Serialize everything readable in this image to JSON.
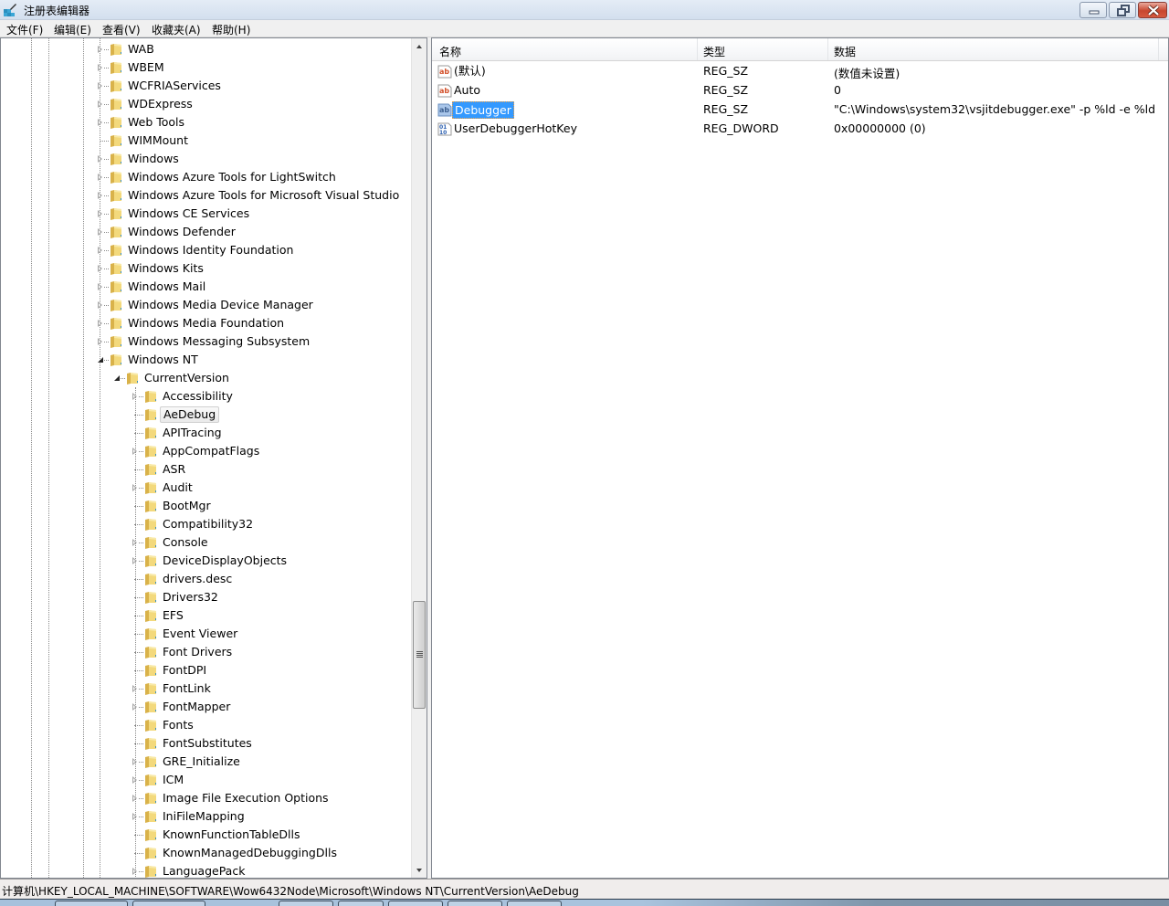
{
  "window": {
    "title": "注册表编辑器",
    "controls": {
      "minimize": "minimize",
      "maximize": "restore",
      "close": "close"
    }
  },
  "menu": [
    {
      "label": "文件(F)"
    },
    {
      "label": "编辑(E)"
    },
    {
      "label": "查看(V)"
    },
    {
      "label": "收藏夹(A)"
    },
    {
      "label": "帮助(H)"
    }
  ],
  "tree": {
    "items": [
      {
        "label": "WAB",
        "level": 0,
        "expander": "closed"
      },
      {
        "label": "WBEM",
        "level": 0,
        "expander": "closed"
      },
      {
        "label": "WCFRIAServices",
        "level": 0,
        "expander": "closed"
      },
      {
        "label": "WDExpress",
        "level": 0,
        "expander": "closed"
      },
      {
        "label": "Web Tools",
        "level": 0,
        "expander": "closed"
      },
      {
        "label": "WIMMount",
        "level": 0,
        "expander": "none"
      },
      {
        "label": "Windows",
        "level": 0,
        "expander": "closed"
      },
      {
        "label": "Windows Azure Tools for LightSwitch",
        "level": 0,
        "expander": "closed"
      },
      {
        "label": "Windows Azure Tools for Microsoft Visual Studio",
        "level": 0,
        "expander": "closed"
      },
      {
        "label": "Windows CE Services",
        "level": 0,
        "expander": "closed"
      },
      {
        "label": "Windows Defender",
        "level": 0,
        "expander": "closed"
      },
      {
        "label": "Windows Identity Foundation",
        "level": 0,
        "expander": "closed"
      },
      {
        "label": "Windows Kits",
        "level": 0,
        "expander": "closed"
      },
      {
        "label": "Windows Mail",
        "level": 0,
        "expander": "closed"
      },
      {
        "label": "Windows Media Device Manager",
        "level": 0,
        "expander": "closed"
      },
      {
        "label": "Windows Media Foundation",
        "level": 0,
        "expander": "closed"
      },
      {
        "label": "Windows Messaging Subsystem",
        "level": 0,
        "expander": "closed"
      },
      {
        "label": "Windows NT",
        "level": 0,
        "expander": "open"
      },
      {
        "label": "CurrentVersion",
        "level": 1,
        "expander": "open"
      },
      {
        "label": "Accessibility",
        "level": 2,
        "expander": "closed"
      },
      {
        "label": "AeDebug",
        "level": 2,
        "expander": "none",
        "selected": true
      },
      {
        "label": "APITracing",
        "level": 2,
        "expander": "none"
      },
      {
        "label": "AppCompatFlags",
        "level": 2,
        "expander": "closed"
      },
      {
        "label": "ASR",
        "level": 2,
        "expander": "none"
      },
      {
        "label": "Audit",
        "level": 2,
        "expander": "closed"
      },
      {
        "label": "BootMgr",
        "level": 2,
        "expander": "none"
      },
      {
        "label": "Compatibility32",
        "level": 2,
        "expander": "none"
      },
      {
        "label": "Console",
        "level": 2,
        "expander": "closed"
      },
      {
        "label": "DeviceDisplayObjects",
        "level": 2,
        "expander": "closed"
      },
      {
        "label": "drivers.desc",
        "level": 2,
        "expander": "none"
      },
      {
        "label": "Drivers32",
        "level": 2,
        "expander": "none"
      },
      {
        "label": "EFS",
        "level": 2,
        "expander": "none"
      },
      {
        "label": "Event Viewer",
        "level": 2,
        "expander": "none"
      },
      {
        "label": "Font Drivers",
        "level": 2,
        "expander": "none"
      },
      {
        "label": "FontDPI",
        "level": 2,
        "expander": "none"
      },
      {
        "label": "FontLink",
        "level": 2,
        "expander": "closed"
      },
      {
        "label": "FontMapper",
        "level": 2,
        "expander": "closed"
      },
      {
        "label": "Fonts",
        "level": 2,
        "expander": "none"
      },
      {
        "label": "FontSubstitutes",
        "level": 2,
        "expander": "none"
      },
      {
        "label": "GRE_Initialize",
        "level": 2,
        "expander": "closed"
      },
      {
        "label": "ICM",
        "level": 2,
        "expander": "closed"
      },
      {
        "label": "Image File Execution Options",
        "level": 2,
        "expander": "closed"
      },
      {
        "label": "IniFileMapping",
        "level": 2,
        "expander": "closed"
      },
      {
        "label": "KnownFunctionTableDlls",
        "level": 2,
        "expander": "none"
      },
      {
        "label": "KnownManagedDebuggingDlls",
        "level": 2,
        "expander": "none"
      },
      {
        "label": "LanguagePack",
        "level": 2,
        "expander": "closed"
      }
    ]
  },
  "list": {
    "columns": {
      "name": "名称",
      "type": "类型",
      "data": "数据"
    },
    "rows": [
      {
        "icon": "string-value-icon",
        "name": "(默认)",
        "type": "REG_SZ",
        "data": "(数值未设置)"
      },
      {
        "icon": "string-value-icon",
        "name": "Auto",
        "type": "REG_SZ",
        "data": "0"
      },
      {
        "icon": "string-value-icon",
        "name": "Debugger",
        "type": "REG_SZ",
        "data": "\"C:\\Windows\\system32\\vsjitdebugger.exe\" -p %ld -e %ld",
        "selected": true
      },
      {
        "icon": "binary-value-icon",
        "name": "UserDebuggerHotKey",
        "type": "REG_DWORD",
        "data": "0x00000000 (0)"
      }
    ]
  },
  "status": {
    "path": "计算机\\HKEY_LOCAL_MACHINE\\SOFTWARE\\Wow6432Node\\Microsoft\\Windows NT\\CurrentVersion\\AeDebug"
  },
  "colors": {
    "selection": "#3399ff",
    "folder": "#e8c65a",
    "string_icon": "#d2502a",
    "binary_icon": "#2b5fb0"
  }
}
